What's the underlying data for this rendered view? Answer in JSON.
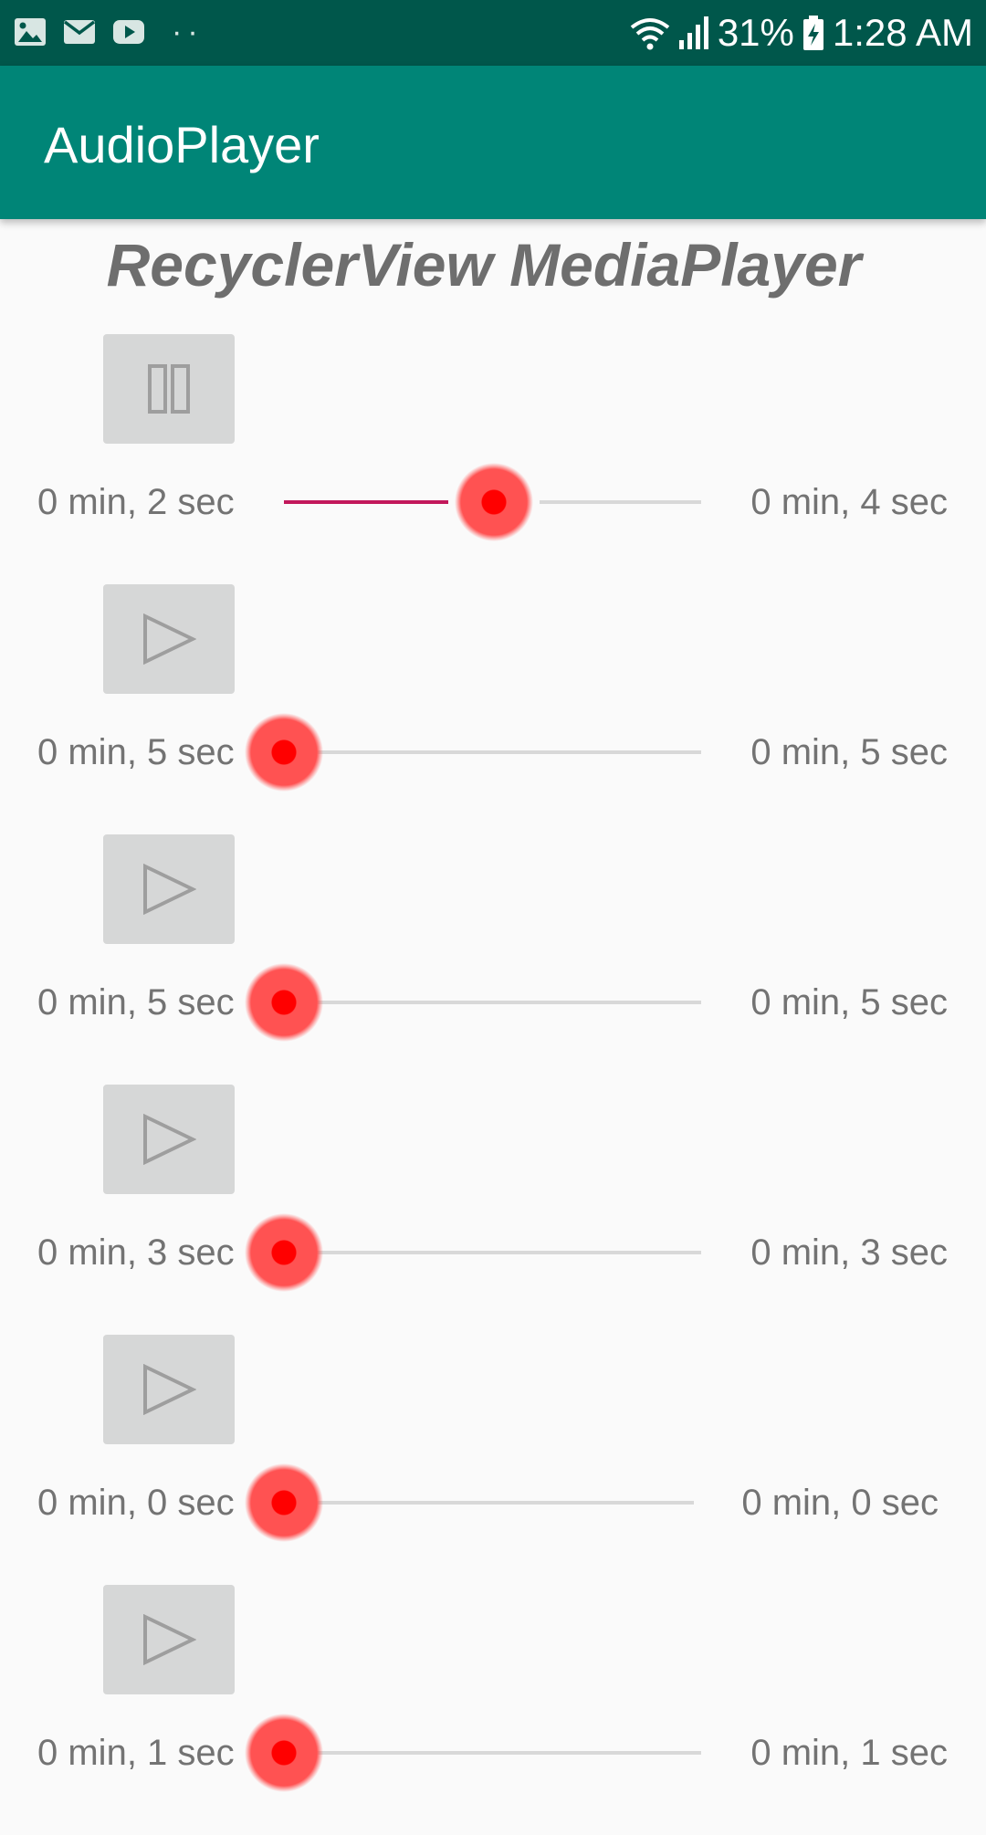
{
  "status_bar": {
    "notification_icons": [
      "image-icon",
      "mail-icon",
      "youtube-icon",
      "more-dots-icon"
    ],
    "system_icons": [
      "wifi-icon",
      "signal-icon",
      "battery-charging-icon"
    ],
    "battery": "31%",
    "time": "1:28 AM"
  },
  "app_bar": {
    "title": "AudioPlayer"
  },
  "list": {
    "header": "RecyclerView MediaPlayer",
    "items": [
      {
        "state": "playing",
        "icon": "pause-icon",
        "elapsed": "0 min, 2 sec",
        "total": "0 min, 4 sec",
        "progress": 0.5
      },
      {
        "state": "paused",
        "icon": "play-icon",
        "elapsed": "0 min, 5 sec",
        "total": "0 min, 5 sec",
        "progress": 0
      },
      {
        "state": "paused",
        "icon": "play-icon",
        "elapsed": "0 min, 5 sec",
        "total": "0 min, 5 sec",
        "progress": 0
      },
      {
        "state": "paused",
        "icon": "play-icon",
        "elapsed": "0 min, 3 sec",
        "total": "0 min, 3 sec",
        "progress": 0
      },
      {
        "state": "paused",
        "icon": "play-icon",
        "elapsed": "0 min, 0 sec",
        "total": "0 min, 0 sec",
        "progress": 0
      },
      {
        "state": "paused",
        "icon": "play-icon",
        "elapsed": "0 min, 1 sec",
        "total": "0 min, 1 sec",
        "progress": 0
      }
    ]
  },
  "colors": {
    "status_bar": "#00574b",
    "app_bar": "#008577",
    "seek_progress": "#c2185b",
    "seek_thumb": "#ff5252",
    "button_bg": "#d6d7d7"
  }
}
